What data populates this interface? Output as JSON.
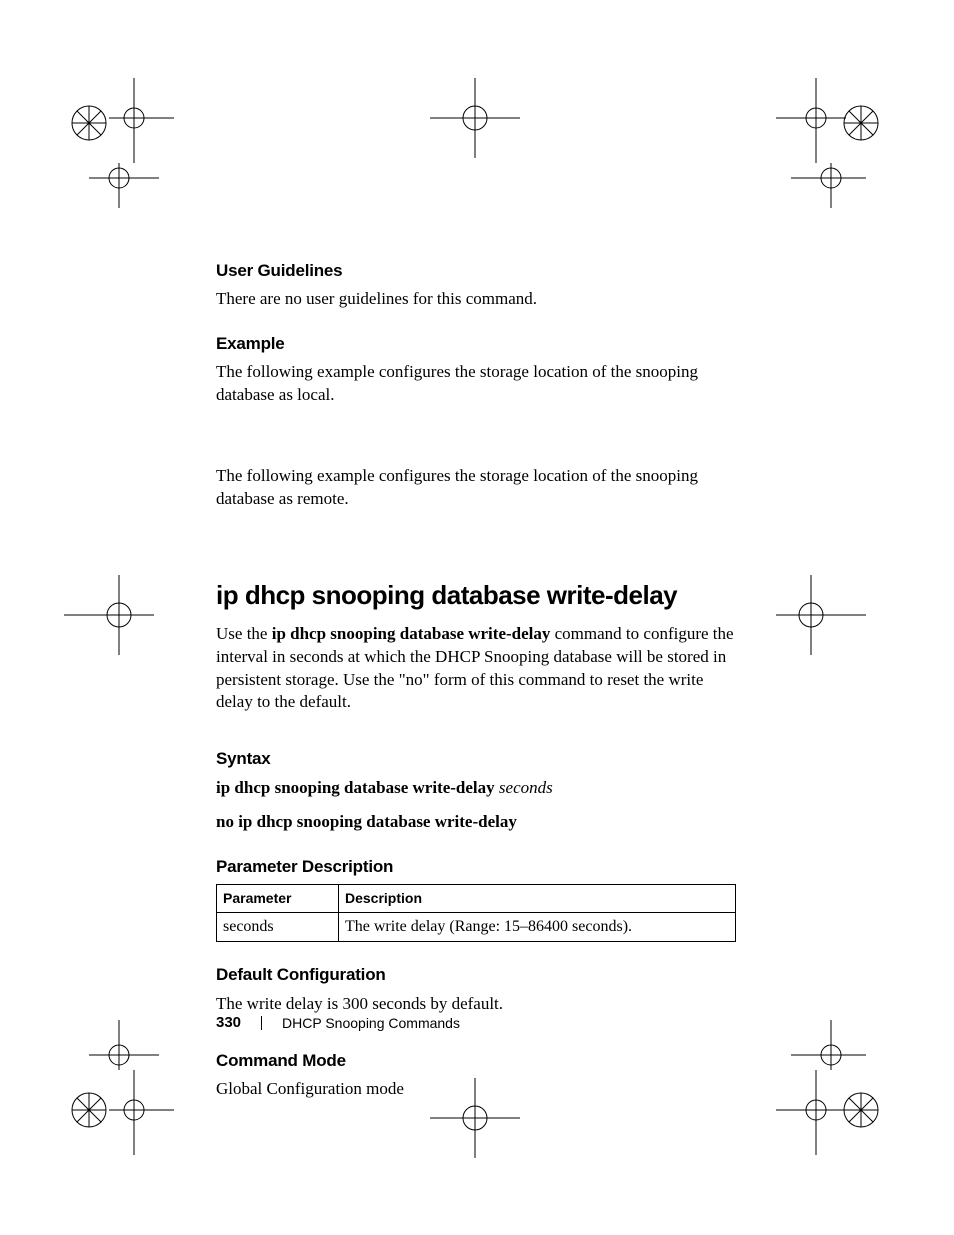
{
  "sections": {
    "userGuidelines": {
      "title": "User Guidelines",
      "body": "There are no user guidelines for this command."
    },
    "example": {
      "title": "Example",
      "body1": "The following example configures the storage location of the snooping database as local.",
      "body2": "The following example configures the storage location of the snooping database as remote."
    },
    "command": {
      "title": "ip dhcp snooping database write-delay",
      "intro_prefix": "Use the ",
      "intro_bold": "ip dhcp snooping database write-delay",
      "intro_suffix": " command to configure the interval in seconds at which the DHCP Snooping database will be stored in persistent storage. Use the \"no\" form of this command to reset the write delay to the default."
    },
    "syntax": {
      "title": "Syntax",
      "line1_bold": "ip dhcp snooping database write-delay ",
      "line1_italic": "seconds",
      "line2": "no ip dhcp snooping database write-delay"
    },
    "paramDesc": {
      "title": "Parameter Description",
      "headers": {
        "param": "Parameter",
        "desc": "Description"
      },
      "rows": [
        {
          "param": "seconds",
          "desc": "The write delay (Range: 15–86400 seconds)."
        }
      ]
    },
    "defaultConfig": {
      "title": "Default Configuration",
      "body": "The write delay is 300 seconds by default."
    },
    "commandMode": {
      "title": "Command Mode",
      "body": "Global Configuration mode"
    }
  },
  "footer": {
    "page": "330",
    "chapter": "DHCP Snooping Commands"
  }
}
